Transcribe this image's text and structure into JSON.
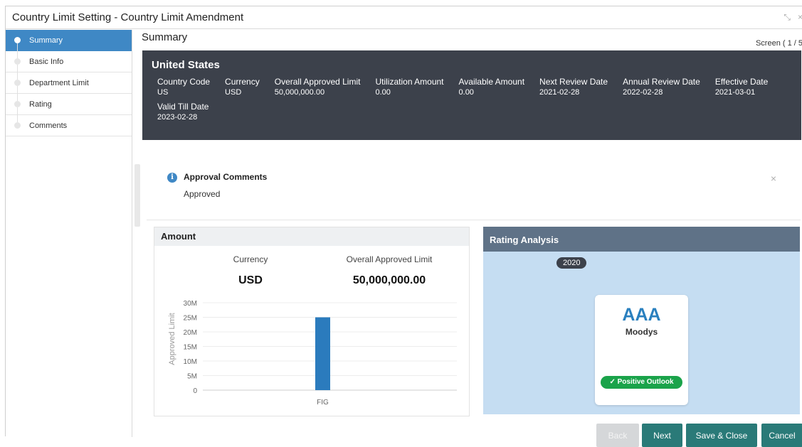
{
  "window": {
    "title": "Country Limit Setting - Country Limit Amendment"
  },
  "sidebar": {
    "items": [
      {
        "label": "Summary"
      },
      {
        "label": "Basic Info"
      },
      {
        "label": "Department Limit"
      },
      {
        "label": "Rating"
      },
      {
        "label": "Comments"
      }
    ]
  },
  "main": {
    "title": "Summary",
    "screen_count": "Screen ( 1 / 5"
  },
  "summary": {
    "country": "United States",
    "fields": [
      {
        "label": "Country Code",
        "value": "US"
      },
      {
        "label": "Currency",
        "value": "USD"
      },
      {
        "label": "Overall Approved Limit",
        "value": "50,000,000.00"
      },
      {
        "label": "Utilization Amount",
        "value": "0.00"
      },
      {
        "label": "Available Amount",
        "value": "0.00"
      },
      {
        "label": "Next Review Date",
        "value": "2021-02-28"
      },
      {
        "label": "Annual Review Date",
        "value": "2022-02-28"
      },
      {
        "label": "Effective Date",
        "value": "2021-03-01"
      },
      {
        "label": "Valid Till Date",
        "value": "2023-02-28"
      }
    ]
  },
  "comments": {
    "title": "Approval Comments",
    "text": "Approved",
    "close_icon": "×"
  },
  "amount": {
    "title": "Amount",
    "currency_label": "Currency",
    "currency_value": "USD",
    "limit_label": "Overall Approved Limit",
    "limit_value": "50,000,000.00"
  },
  "chart_data": {
    "type": "bar",
    "categories": [
      "FIG"
    ],
    "values": [
      25000000
    ],
    "ylabel": "Approved Limit",
    "xlabel": "",
    "ylim": [
      0,
      30000000
    ],
    "yticks": [
      "0",
      "5M",
      "10M",
      "15M",
      "20M",
      "25M",
      "30M"
    ],
    "ytick_values": [
      0,
      5000000,
      10000000,
      15000000,
      20000000,
      25000000,
      30000000
    ],
    "grid": true,
    "bar_color": "#2b7bbd"
  },
  "rating": {
    "title": "Rating Analysis",
    "year": "2020",
    "grade": "AAA",
    "agency": "Moodys",
    "outlook": "✓ Positive Outlook"
  },
  "buttons": {
    "back": "Back",
    "next": "Next",
    "save_close": "Save & Close",
    "cancel": "Cancel"
  },
  "colors": {
    "primary": "#3f88c5",
    "dark_header": "#3c414b",
    "teal_button": "#2a7a78",
    "disabled_button": "#d5d7d9",
    "positive": "#1aa34a"
  }
}
